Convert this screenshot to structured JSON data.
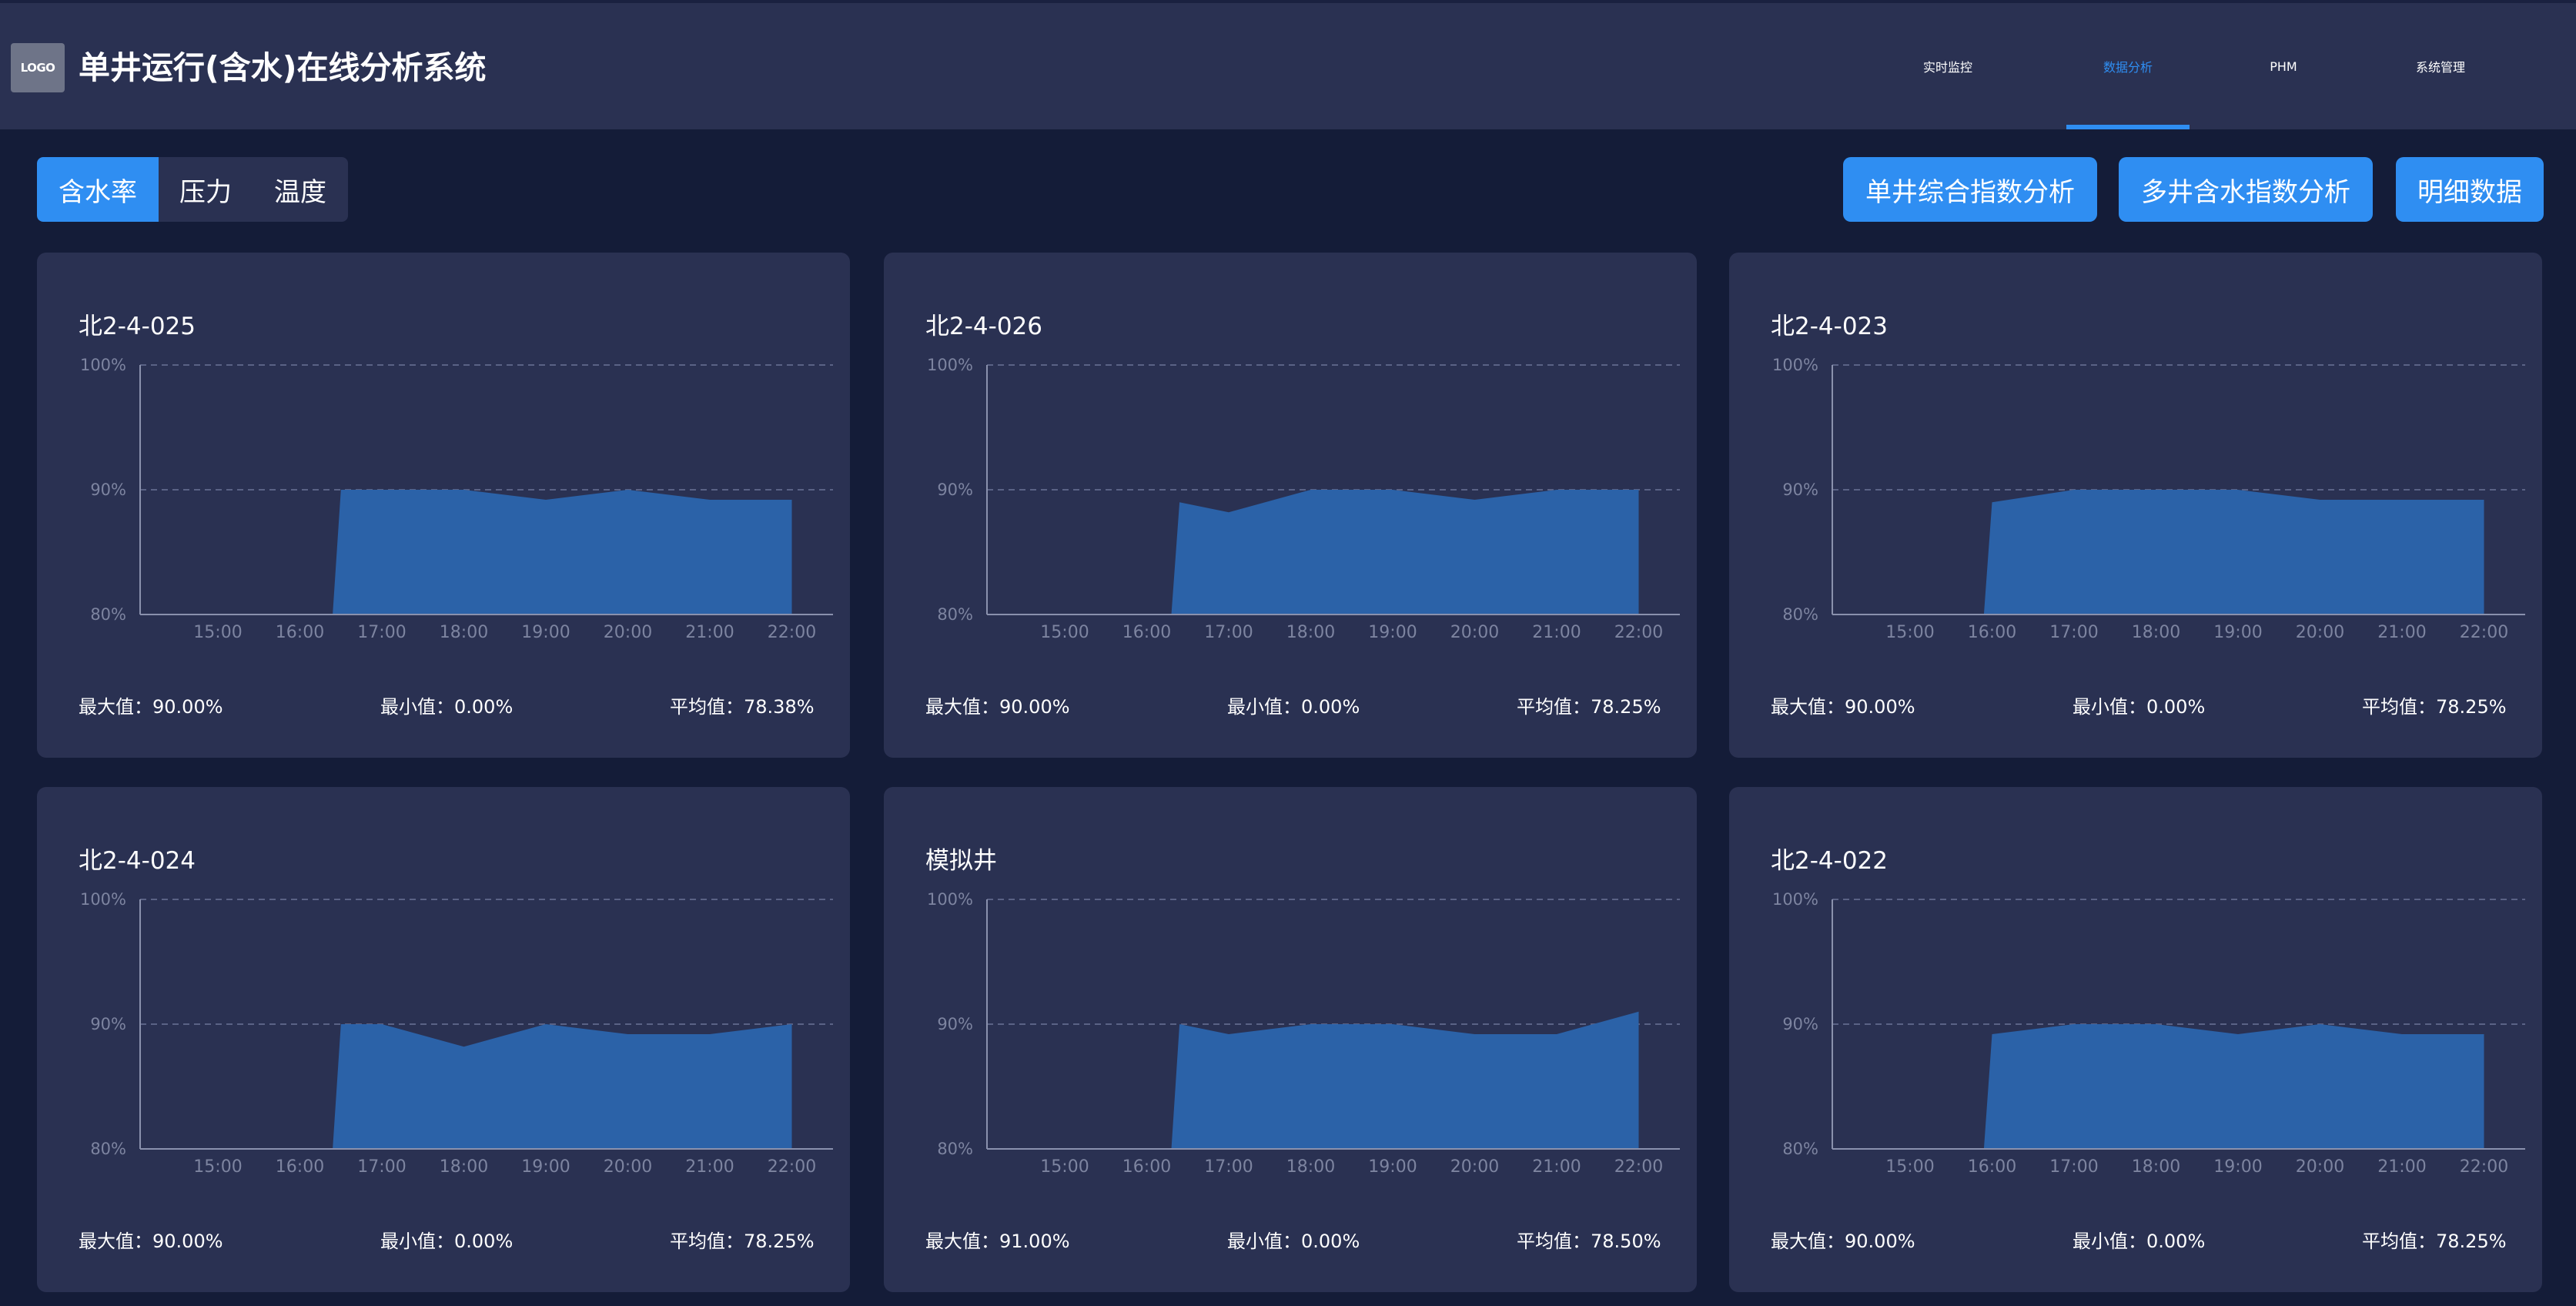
{
  "header": {
    "logo_text": "LOGO",
    "title": "单井运行(含水)在线分析系统",
    "nav": [
      {
        "label": "实时监控",
        "active": false
      },
      {
        "label": "数据分析",
        "active": true
      },
      {
        "label": "PHM",
        "active": false
      },
      {
        "label": "系统管理",
        "active": false
      }
    ]
  },
  "toolbar": {
    "tabs": [
      {
        "label": "含水率",
        "active": true
      },
      {
        "label": "压力",
        "active": false
      },
      {
        "label": "温度",
        "active": false
      }
    ],
    "actions": [
      {
        "label": "单井综合指数分析"
      },
      {
        "label": "多井含水指数分析"
      },
      {
        "label": "明细数据"
      }
    ]
  },
  "colors": {
    "accent": "#2f8ef2",
    "area_fill": "#2b62a8",
    "card_bg": "#2a3152",
    "page_bg": "#141c38"
  },
  "stats_labels": {
    "max": "最大值：",
    "min": "最小值：",
    "avg": "平均值："
  },
  "chart_data": [
    {
      "type": "area",
      "title": "北2-4-025",
      "x": [
        "15:00",
        "16:00",
        "17:00",
        "18:00",
        "19:00",
        "20:00",
        "21:00",
        "22:00"
      ],
      "yticks": [
        "80%",
        "90%",
        "100%"
      ],
      "ylim": [
        80,
        100
      ],
      "points": [
        [
          15.0,
          80
        ],
        [
          16.4,
          80
        ],
        [
          16.5,
          90
        ],
        [
          18.0,
          90
        ],
        [
          19.0,
          89.2
        ],
        [
          20.0,
          90
        ],
        [
          21.0,
          89.2
        ],
        [
          22.0,
          89.2
        ]
      ],
      "grid": true,
      "stats": {
        "max": "90.00%",
        "min": "0.00%",
        "avg": "78.38%"
      }
    },
    {
      "type": "area",
      "title": "北2-4-026",
      "x": [
        "15:00",
        "16:00",
        "17:00",
        "18:00",
        "19:00",
        "20:00",
        "21:00",
        "22:00"
      ],
      "yticks": [
        "80%",
        "90%",
        "100%"
      ],
      "ylim": [
        80,
        100
      ],
      "points": [
        [
          15.0,
          80
        ],
        [
          16.3,
          80
        ],
        [
          16.4,
          89
        ],
        [
          17.0,
          88.2
        ],
        [
          18.0,
          90
        ],
        [
          19.0,
          90
        ],
        [
          20.0,
          89.2
        ],
        [
          21.0,
          90
        ],
        [
          22.0,
          90
        ]
      ],
      "grid": true,
      "stats": {
        "max": "90.00%",
        "min": "0.00%",
        "avg": "78.25%"
      }
    },
    {
      "type": "area",
      "title": "北2-4-023",
      "x": [
        "15:00",
        "16:00",
        "17:00",
        "18:00",
        "19:00",
        "20:00",
        "21:00",
        "22:00"
      ],
      "yticks": [
        "80%",
        "90%",
        "100%"
      ],
      "ylim": [
        80,
        100
      ],
      "points": [
        [
          15.0,
          80
        ],
        [
          15.9,
          80
        ],
        [
          16.0,
          89
        ],
        [
          17.0,
          90
        ],
        [
          18.0,
          90
        ],
        [
          19.0,
          90
        ],
        [
          20.0,
          89.2
        ],
        [
          21.0,
          89.2
        ],
        [
          22.0,
          89.2
        ]
      ],
      "grid": true,
      "stats": {
        "max": "90.00%",
        "min": "0.00%",
        "avg": "78.25%"
      }
    },
    {
      "type": "area",
      "title": "北2-4-024",
      "x": [
        "15:00",
        "16:00",
        "17:00",
        "18:00",
        "19:00",
        "20:00",
        "21:00",
        "22:00"
      ],
      "yticks": [
        "80%",
        "90%",
        "100%"
      ],
      "ylim": [
        80,
        100
      ],
      "points": [
        [
          15.0,
          80
        ],
        [
          16.4,
          80
        ],
        [
          16.5,
          90
        ],
        [
          17.0,
          90
        ],
        [
          18.0,
          88.2
        ],
        [
          19.0,
          90
        ],
        [
          20.0,
          89.2
        ],
        [
          21.0,
          89.2
        ],
        [
          22.0,
          90
        ]
      ],
      "grid": true,
      "stats": {
        "max": "90.00%",
        "min": "0.00%",
        "avg": "78.25%"
      }
    },
    {
      "type": "area",
      "title": "模拟井",
      "x": [
        "15:00",
        "16:00",
        "17:00",
        "18:00",
        "19:00",
        "20:00",
        "21:00",
        "22:00"
      ],
      "yticks": [
        "80%",
        "90%",
        "100%"
      ],
      "ylim": [
        80,
        100
      ],
      "points": [
        [
          15.0,
          80
        ],
        [
          16.3,
          80
        ],
        [
          16.4,
          90
        ],
        [
          17.0,
          89.2
        ],
        [
          18.0,
          90
        ],
        [
          19.0,
          90
        ],
        [
          20.0,
          89.2
        ],
        [
          21.0,
          89.2
        ],
        [
          22.0,
          91
        ]
      ],
      "grid": true,
      "stats": {
        "max": "91.00%",
        "min": "0.00%",
        "avg": "78.50%"
      }
    },
    {
      "type": "area",
      "title": "北2-4-022",
      "x": [
        "15:00",
        "16:00",
        "17:00",
        "18:00",
        "19:00",
        "20:00",
        "21:00",
        "22:00"
      ],
      "yticks": [
        "80%",
        "90%",
        "100%"
      ],
      "ylim": [
        80,
        100
      ],
      "points": [
        [
          15.0,
          80
        ],
        [
          15.9,
          80
        ],
        [
          16.0,
          89.2
        ],
        [
          17.0,
          90
        ],
        [
          18.0,
          90
        ],
        [
          19.0,
          89.2
        ],
        [
          20.0,
          90
        ],
        [
          21.0,
          89.2
        ],
        [
          22.0,
          89.2
        ]
      ],
      "grid": true,
      "stats": {
        "max": "90.00%",
        "min": "0.00%",
        "avg": "78.25%"
      }
    }
  ]
}
